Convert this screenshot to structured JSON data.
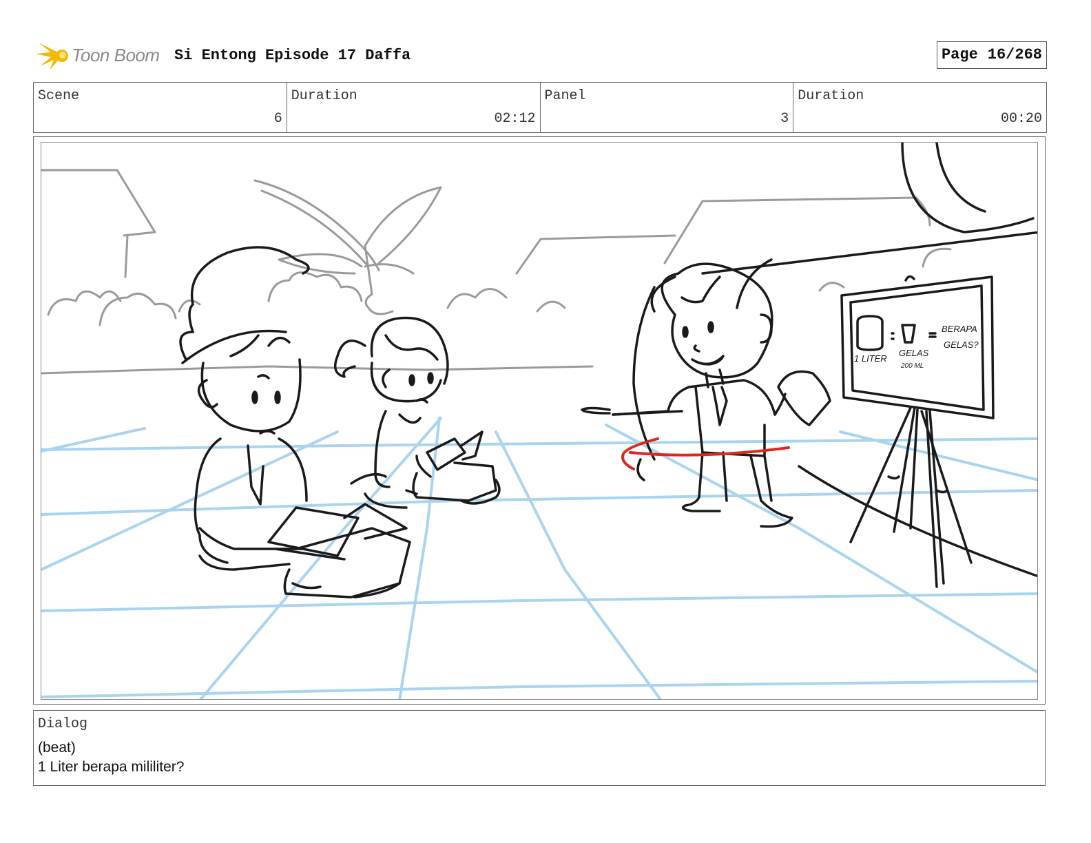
{
  "header": {
    "logo_text": "Toon Boom",
    "title": "Si Entong Episode 17 Daffa",
    "page_label": "Page",
    "page_number": "16/268"
  },
  "info": {
    "scene_label": "Scene",
    "scene_value": "6",
    "scene_duration_label": "Duration",
    "scene_duration_value": "02:12",
    "panel_label": "Panel",
    "panel_value": "3",
    "panel_duration_label": "Duration",
    "panel_duration_value": "00:20"
  },
  "board": {
    "lines": [
      "1 LITER",
      "GELAS",
      "200 ML",
      "BERAPA",
      "GELAS?"
    ]
  },
  "dialog": {
    "label": "Dialog",
    "lines": [
      "(beat)",
      "1 Liter berapa mililiter?"
    ]
  },
  "colors": {
    "logo_star": "#f5b800",
    "grid_blue": "#a9d4ef",
    "sketch_grey": "#9a9a9a",
    "ink": "#1a1a1a",
    "red_mark": "#d9291c"
  }
}
